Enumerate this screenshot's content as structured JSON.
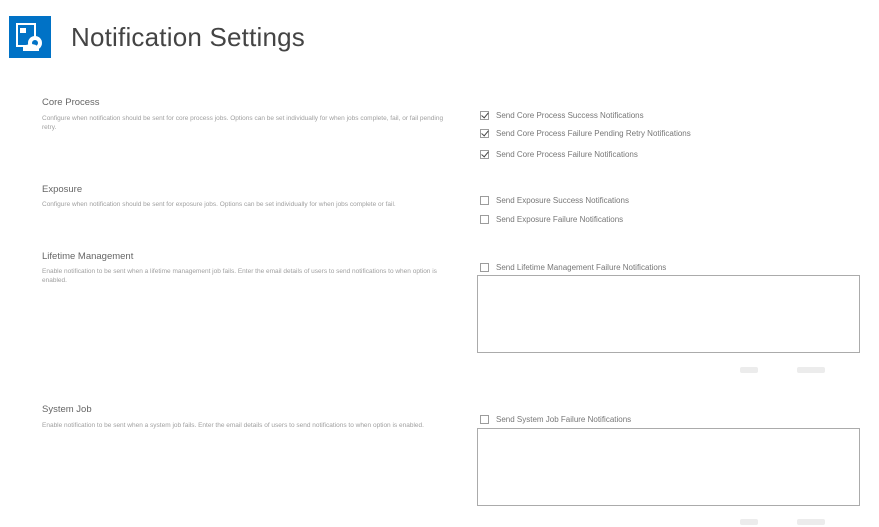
{
  "header": {
    "title": "Notification Settings",
    "icon": "sharepoint-settings-icon",
    "accent_color": "#0072c6"
  },
  "sections": {
    "core": {
      "title": "Core Process",
      "description": "Configure when notification should be sent for core process jobs. Options can be set individually for when jobs complete, fail, or fail pending retry.",
      "options": [
        {
          "label": "Send Core Process Success Notifications",
          "checked": true
        },
        {
          "label": "Send Core Process Failure Pending Retry Notifications",
          "checked": true
        },
        {
          "label": "Send Core Process Failure Notifications",
          "checked": true
        }
      ]
    },
    "exposure": {
      "title": "Exposure",
      "description": "Configure when notification should be sent for exposure jobs. Options can be set individually for when jobs complete or fail.",
      "options": [
        {
          "label": "Send Exposure Success Notifications",
          "checked": false
        },
        {
          "label": "Send Exposure Failure Notifications",
          "checked": false
        }
      ]
    },
    "lifetime": {
      "title": "Lifetime Management",
      "description": "Enable notification to be sent when a lifetime management job fails. Enter the email details of users to send notifications to when option is enabled.",
      "option": {
        "label": "Send Lifetime Management Failure Notifications",
        "checked": false
      },
      "recipients_value": ""
    },
    "system": {
      "title": "System Job",
      "description": "Enable notification to be sent when a system job fails. Enter the email details of users to send notifications to when option is enabled.",
      "option": {
        "label": "Send System Job Failure Notifications",
        "checked": false
      },
      "recipients_value": ""
    }
  }
}
